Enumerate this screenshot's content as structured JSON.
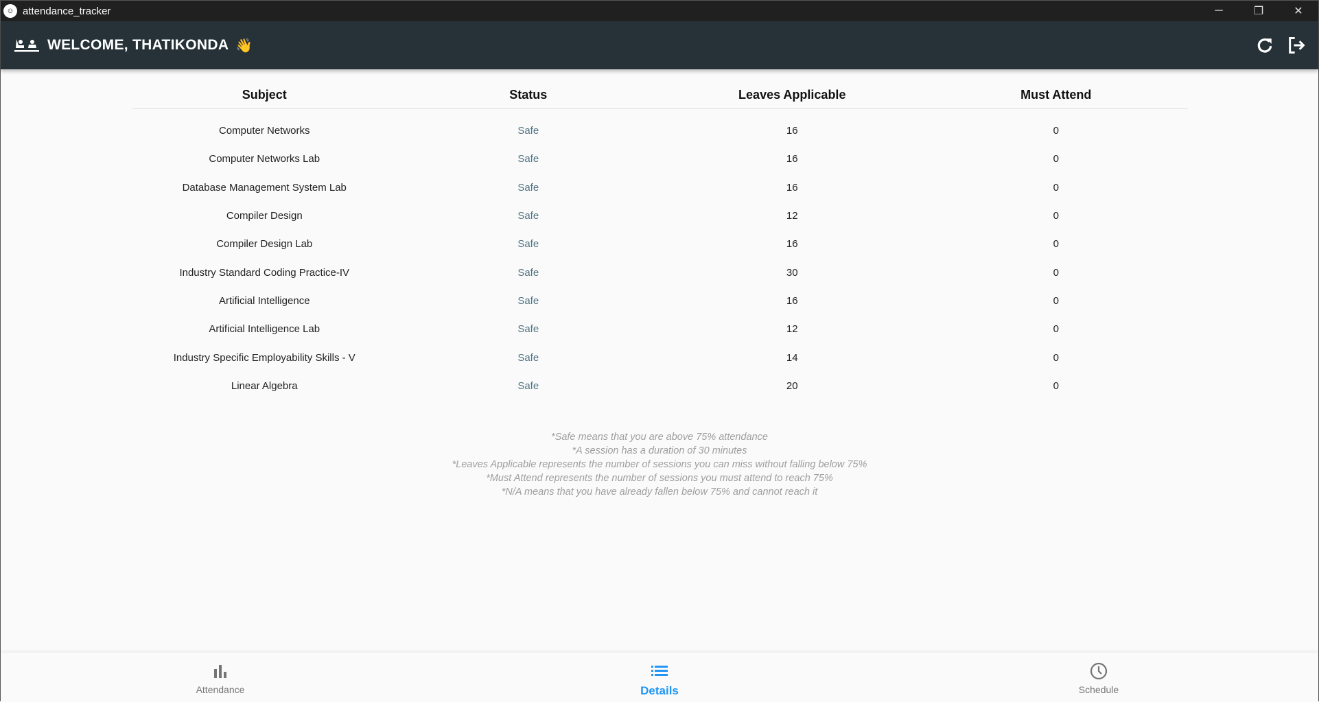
{
  "window": {
    "title": "attendance_tracker"
  },
  "appbar": {
    "welcome": "WELCOME, THATIKONDA",
    "emoji": "👋"
  },
  "table": {
    "headers": [
      "Subject",
      "Status",
      "Leaves Applicable",
      "Must Attend"
    ],
    "rows": [
      {
        "subject": "Computer Networks",
        "status": "Safe",
        "leaves": "16",
        "must": "0"
      },
      {
        "subject": "Computer Networks Lab",
        "status": "Safe",
        "leaves": "16",
        "must": "0"
      },
      {
        "subject": "Database Management System Lab",
        "status": "Safe",
        "leaves": "16",
        "must": "0"
      },
      {
        "subject": "Compiler Design",
        "status": "Safe",
        "leaves": "12",
        "must": "0"
      },
      {
        "subject": "Compiler Design Lab",
        "status": "Safe",
        "leaves": "16",
        "must": "0"
      },
      {
        "subject": "Industry Standard Coding Practice-IV",
        "status": "Safe",
        "leaves": "30",
        "must": "0"
      },
      {
        "subject": "Artificial Intelligence",
        "status": "Safe",
        "leaves": "16",
        "must": "0"
      },
      {
        "subject": "Artificial Intelligence Lab",
        "status": "Safe",
        "leaves": "12",
        "must": "0"
      },
      {
        "subject": "Industry Specific Employability Skills - V",
        "status": "Safe",
        "leaves": "14",
        "must": "0"
      },
      {
        "subject": "Linear Algebra",
        "status": "Safe",
        "leaves": "20",
        "must": "0"
      }
    ]
  },
  "notes": [
    "*Safe means that you are above 75% attendance",
    "*A session has a duration of 30 minutes",
    "*Leaves Applicable represents the number of sessions you can miss without falling below 75%",
    "*Must Attend represents the number of sessions you must attend to reach 75%",
    "*N/A means that you have already fallen below 75% and cannot reach it"
  ],
  "bottom_nav": [
    {
      "label": "Attendance",
      "icon": "bar-chart-icon",
      "active": false
    },
    {
      "label": "Details",
      "icon": "list-icon",
      "active": true
    },
    {
      "label": "Schedule",
      "icon": "clock-icon",
      "active": false
    }
  ],
  "colors": {
    "appbar": "#263238",
    "active": "#2196f3",
    "status_safe": "#4f7482"
  }
}
